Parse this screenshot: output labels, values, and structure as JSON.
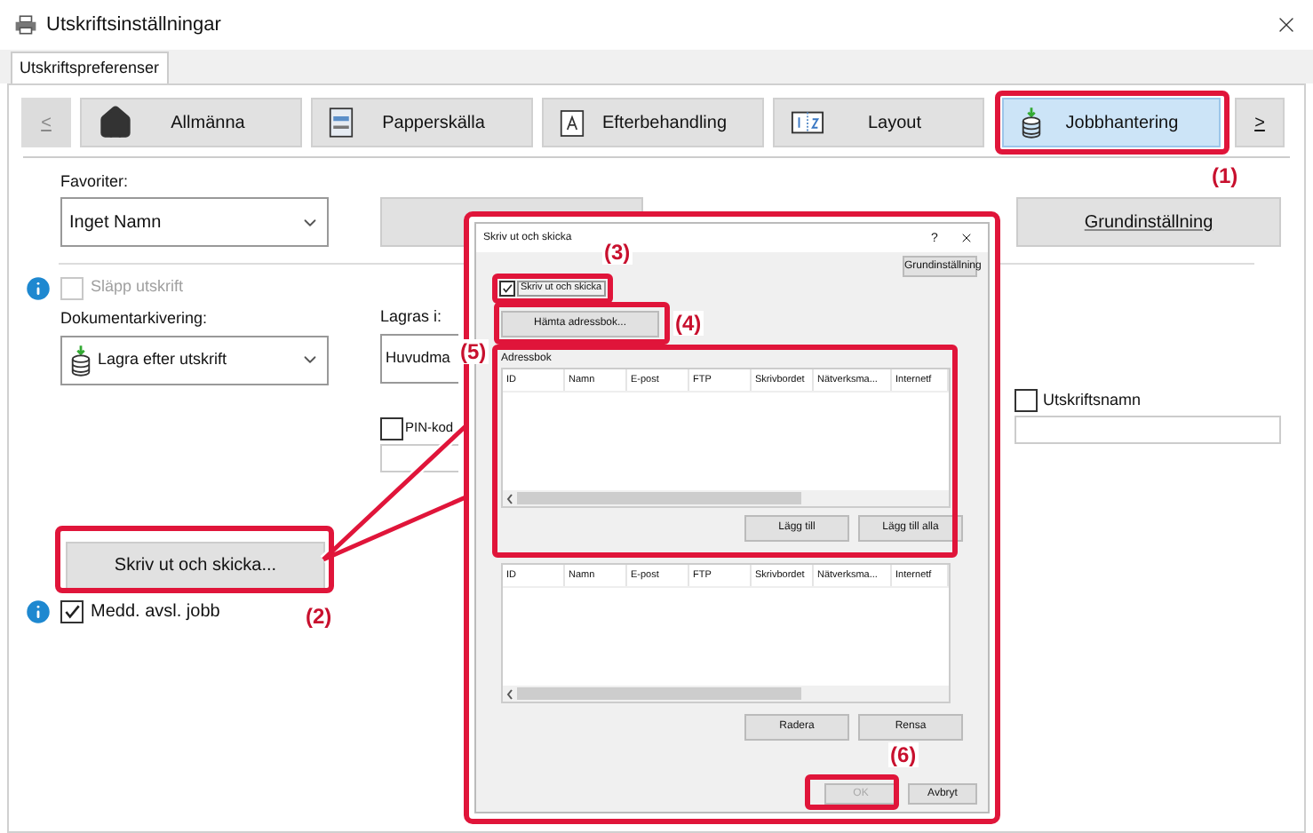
{
  "window": {
    "title": "Utskriftsinställningar"
  },
  "tabs": [
    {
      "label": "Utskriftspreferenser",
      "selected": true
    }
  ],
  "nav": {
    "prev": "<",
    "next": ">",
    "items": [
      {
        "label": "Allmänna",
        "selected": false
      },
      {
        "label": "Papperskälla",
        "selected": false
      },
      {
        "label": "Efterbehandling",
        "selected": false
      },
      {
        "label": "Layout",
        "selected": false
      },
      {
        "label": "Jobbhantering",
        "selected": true
      }
    ]
  },
  "favorites": {
    "label": "Favoriter:",
    "value": "Inget Namn"
  },
  "default_button": "Grundinställning",
  "release_print": {
    "label": "Släpp utskrift",
    "checked": false,
    "disabled": true
  },
  "document_filing": {
    "label": "Dokumentarkivering:",
    "value": "Lagra efter utskrift"
  },
  "store_in": {
    "label": "Lagras i:",
    "value": "Huvudma"
  },
  "pin": {
    "label": "PIN-kod",
    "checked": false
  },
  "print_and_send_button": "Skriv ut och skicka...",
  "job_end_notice": {
    "label": "Medd. avsl. jobb",
    "checked": true
  },
  "print_name": {
    "label": "Utskriftsnamn",
    "checked": false
  },
  "dialog": {
    "title": "Skriv ut och skicka",
    "help": "?",
    "default_button": "Grundinställning",
    "print_and_send": {
      "label": "Skriv ut och skicka",
      "checked": true
    },
    "load_button": "Hämta adressbok...",
    "address_book": {
      "label": "Adressbok",
      "columns": [
        "ID",
        "Namn",
        "E-post",
        "FTP",
        "Skrivbordet",
        "Nätverksma...",
        "Internetf"
      ],
      "buttons": [
        "Lägg till",
        "Lägg till alla"
      ]
    },
    "recipients": {
      "columns": [
        "ID",
        "Namn",
        "E-post",
        "FTP",
        "Skrivbordet",
        "Nätverksma...",
        "Internetf"
      ],
      "buttons": [
        "Radera",
        "Rensa"
      ]
    },
    "ok": {
      "label": "OK",
      "disabled": true
    },
    "cancel": "Avbryt"
  },
  "callouts": [
    "(1)",
    "(2)",
    "(3)",
    "(4)",
    "(5)",
    "(6)"
  ]
}
